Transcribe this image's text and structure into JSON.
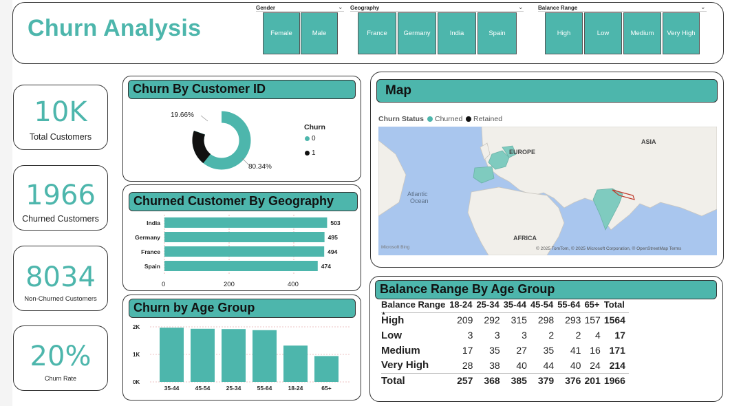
{
  "title": "Churn Analysis",
  "slicers": {
    "gender": {
      "label": "Gender",
      "options": [
        "Female",
        "Male"
      ]
    },
    "geography": {
      "label": "Geography",
      "options": [
        "France",
        "Germany",
        "India",
        "Spain"
      ]
    },
    "balance": {
      "label": "Balance Range",
      "options": [
        "High",
        "Low",
        "Medium",
        "Very High"
      ]
    }
  },
  "kpis": [
    {
      "value": "10K",
      "label": "Total Customers"
    },
    {
      "value": "1966",
      "label": "Churned Customers"
    },
    {
      "value": "8034",
      "label": "Non-Churned Customers"
    },
    {
      "value": "20%",
      "label": "Churn Rate"
    }
  ],
  "donut": {
    "title": "Churn By Customer ID",
    "legend_title": "Churn",
    "legend": [
      "0",
      "1"
    ],
    "label_churned": "19.66%",
    "label_retained": "80.34%",
    "colors": {
      "retained": "#4db6ac",
      "churned": "#111111"
    }
  },
  "geo": {
    "title": "Churned Customer By Geography",
    "ticks": [
      "0",
      "200",
      "400"
    ]
  },
  "age": {
    "title": "Churn by Age Group",
    "ticks": [
      "0K",
      "1K",
      "2K"
    ]
  },
  "map": {
    "title": "Map",
    "legend_title": "Churn Status",
    "legend": [
      "Churned",
      "Retained"
    ],
    "labels": [
      "EUROPE",
      "ASIA",
      "Atlantic",
      "Ocean",
      "AFRICA"
    ],
    "attribution": "© 2025 TomTom, © 2025 Microsoft Corporation, © OpenStreetMap  Terms",
    "logo": "Microsoft Bing"
  },
  "matrix": {
    "title": "Balance Range By Age Group",
    "columns": [
      "Balance Range",
      "18-24",
      "25-34",
      "35-44",
      "45-54",
      "55-64",
      "65+",
      "Total"
    ],
    "rows": [
      [
        "High",
        "209",
        "292",
        "315",
        "298",
        "293",
        "157",
        "1564"
      ],
      [
        "Low",
        "3",
        "3",
        "3",
        "2",
        "2",
        "4",
        "17"
      ],
      [
        "Medium",
        "17",
        "35",
        "27",
        "35",
        "41",
        "16",
        "171"
      ],
      [
        "Very High",
        "28",
        "38",
        "40",
        "44",
        "40",
        "24",
        "214"
      ]
    ],
    "total": [
      "Total",
      "257",
      "368",
      "385",
      "379",
      "376",
      "201",
      "1966"
    ]
  },
  "chart_data": [
    {
      "type": "pie",
      "title": "Churn By Customer ID",
      "categories": [
        "0",
        "1"
      ],
      "values": [
        80.34,
        19.66
      ]
    },
    {
      "type": "bar",
      "title": "Churned Customer By Geography",
      "categories": [
        "India",
        "Germany",
        "France",
        "Spain"
      ],
      "values": [
        503,
        495,
        494,
        474
      ],
      "xlim": [
        0,
        500
      ]
    },
    {
      "type": "bar",
      "title": "Churn by Age Group",
      "categories": [
        "35-44",
        "45-54",
        "25-34",
        "55-64",
        "18-24",
        "65+"
      ],
      "values": [
        1970,
        1930,
        1920,
        1880,
        1320,
        940
      ],
      "ylim": [
        0,
        2000
      ]
    }
  ]
}
